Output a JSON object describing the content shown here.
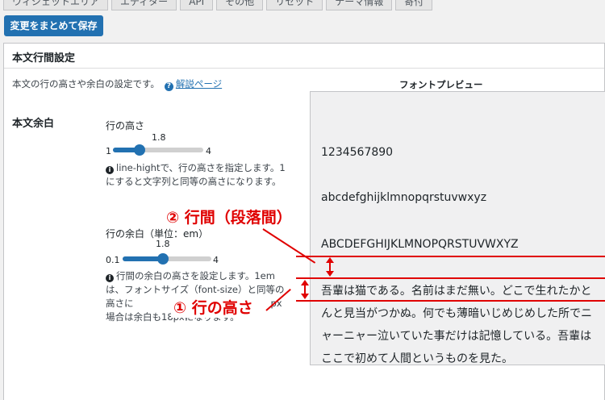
{
  "tabs": [
    "ウィジェットエリア",
    "エディター",
    "API",
    "その他",
    "リセット",
    "テーマ情報",
    "寄付"
  ],
  "save_button": "変更をまとめて保存",
  "section": {
    "title": "本文行間設定",
    "description": "本文の行の高さや余白の設定です。",
    "help_link": "解説ページ"
  },
  "row_label": "本文余白",
  "line_height_control": {
    "label": "行の高さ",
    "value": "1.8",
    "min": "1",
    "max": "4",
    "note_line1": "line-hightで、行の高さを指定します。1",
    "note_line2": "にすると文字列と同等の高さになります。"
  },
  "margin_control": {
    "label": "行の余白（単位：em）",
    "value": "1.8",
    "min": "0.1",
    "max": "4",
    "note_line1": "行間の余白の高さを設定します。1em",
    "note_line2": "は、フォントサイズ（font-size）と同等の",
    "note_line3": "高さに",
    "note_line3b": "px",
    "note_line4": "場合は余白も18pxになります。"
  },
  "preview": {
    "title": "フォントプレビュー",
    "line1": "1234567890",
    "line2": "abcdefghijklmnopqrstuvwxyz",
    "line3": "ABCDEFGHIJKLMNOPQRSTUVWXYZ",
    "paragraph": "吾輩は猫である。名前はまだ無い。どこで生れたかとんと見当がつかぬ。何でも薄暗いじめじめした所でニャーニャー泣いていた事だけは記憶している。吾輩はここで初めて人間というものを見た。"
  },
  "annotations": {
    "gap_label": "② 行間（段落間）",
    "line_height_label": "① 行の高さ"
  },
  "accent_color": "#2271b1",
  "annotation_color": "#e00000"
}
